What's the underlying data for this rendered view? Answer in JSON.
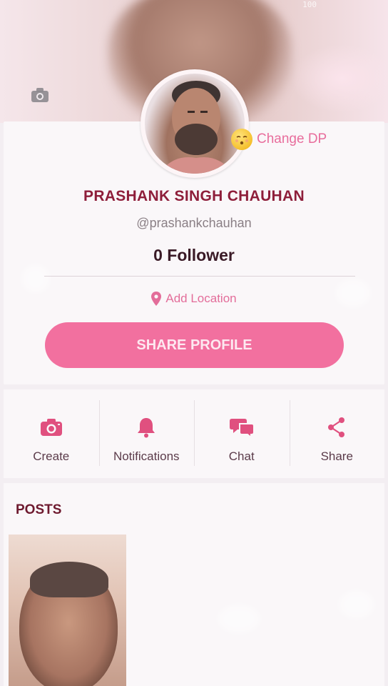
{
  "cover": {
    "status_text": "100"
  },
  "profile": {
    "change_dp_label": "Change DP",
    "name": "PRASHANK SINGH CHAUHAN",
    "handle": "@prashankchauhan",
    "followers": "0 Follower",
    "add_location_label": "Add Location",
    "share_profile_label": "SHARE PROFILE"
  },
  "actions": [
    {
      "label": "Create",
      "icon": "camera-icon"
    },
    {
      "label": "Notifications",
      "icon": "bell-icon"
    },
    {
      "label": "Chat",
      "icon": "chat-bubbles-icon"
    },
    {
      "label": "Share",
      "icon": "share-icon"
    }
  ],
  "posts": {
    "title": "POSTS",
    "count_visible": 1
  },
  "colors": {
    "accent": "#f2709f",
    "name": "#8e1e3a",
    "icon": "#e0507f",
    "background": "#f3eef2"
  }
}
